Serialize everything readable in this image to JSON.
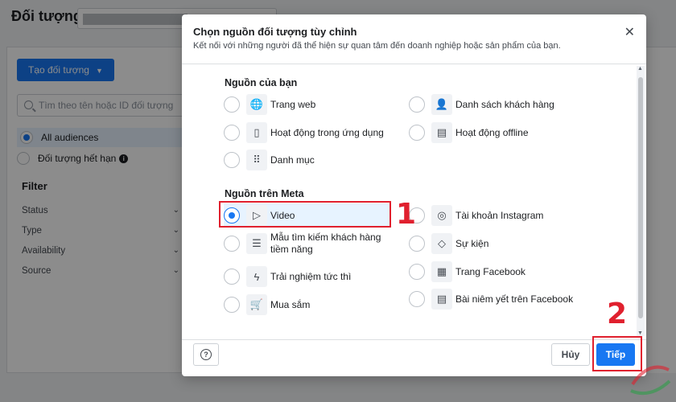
{
  "background": {
    "page_title": "Đối tượng",
    "create_button": "Tạo đối tượng",
    "search_placeholder": "Tìm theo tên hoặc ID đối tượng",
    "audiences": [
      {
        "label": "All audiences",
        "selected": true
      },
      {
        "label": "Đối tượng hết hạn",
        "selected": false
      }
    ],
    "filter_title": "Filter",
    "filters": [
      "Status",
      "Type",
      "Availability",
      "Source"
    ]
  },
  "modal": {
    "title": "Chọn nguồn đối tượng tùy chỉnh",
    "subtitle": "Kết nối với những người đã thể hiện sự quan tâm đến doanh nghiệp hoặc sản phẩm của bạn.",
    "section_your_sources": "Nguồn của bạn",
    "your_sources_left": [
      {
        "label": "Trang web",
        "icon": "globe-icon",
        "glyph": "🌐"
      },
      {
        "label": "Hoạt động trong ứng dụng",
        "icon": "mobile-icon",
        "glyph": "▯"
      },
      {
        "label": "Danh mục",
        "icon": "grid-icon",
        "glyph": "⠿"
      }
    ],
    "your_sources_right": [
      {
        "label": "Danh sách khách hàng",
        "icon": "customer-list-icon",
        "glyph": "👤"
      },
      {
        "label": "Hoạt động offline",
        "icon": "store-icon",
        "glyph": "▤"
      }
    ],
    "section_meta_sources": "Nguồn trên Meta",
    "meta_sources_left": [
      {
        "label": "Video",
        "icon": "play-icon",
        "glyph": "▷",
        "selected": true
      },
      {
        "label": "Mẫu tìm kiếm khách hàng tiềm năng",
        "icon": "lead-form-icon",
        "glyph": "☰"
      },
      {
        "label": "Trải nghiệm tức thì",
        "icon": "lightning-icon",
        "glyph": "ϟ"
      },
      {
        "label": "Mua sắm",
        "icon": "cart-icon",
        "glyph": "🛒"
      }
    ],
    "meta_sources_right": [
      {
        "label": "Tài khoản Instagram",
        "icon": "instagram-icon",
        "glyph": "◎"
      },
      {
        "label": "Sự kiện",
        "icon": "tag-icon",
        "glyph": "◇"
      },
      {
        "label": "Trang Facebook",
        "icon": "page-icon",
        "glyph": "▦"
      },
      {
        "label": "Bài niêm yết trên Facebook",
        "icon": "listing-icon",
        "glyph": "▤"
      }
    ],
    "help_glyph": "?",
    "cancel_label": "Hủy",
    "next_label": "Tiếp",
    "close_glyph": "✕"
  },
  "annotations": {
    "mark_1": "1",
    "mark_2": "2"
  },
  "colors": {
    "accent": "#1877f2",
    "highlight": "#e0202e"
  }
}
